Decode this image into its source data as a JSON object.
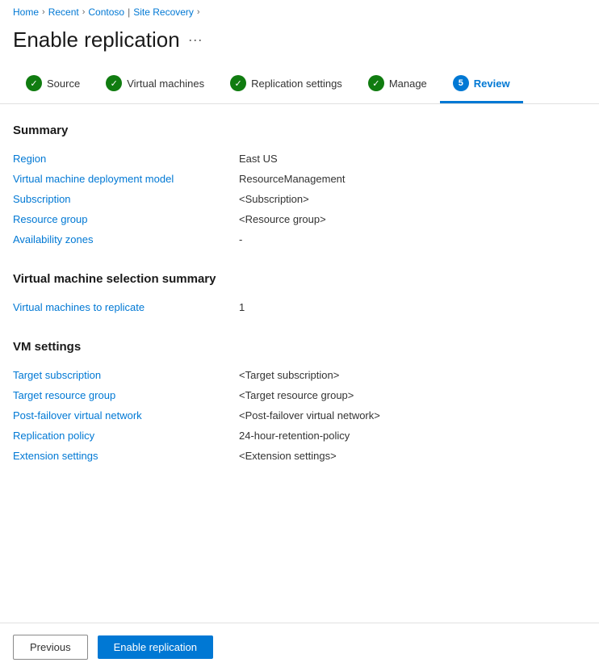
{
  "breadcrumb": {
    "home": "Home",
    "recent": "Recent",
    "contoso": "Contoso",
    "site_recovery": "Site Recovery"
  },
  "page": {
    "title": "Enable replication",
    "menu_icon": "···"
  },
  "tabs": [
    {
      "id": "source",
      "label": "Source",
      "state": "completed"
    },
    {
      "id": "virtual-machines",
      "label": "Virtual machines",
      "state": "completed"
    },
    {
      "id": "replication-settings",
      "label": "Replication settings",
      "state": "completed"
    },
    {
      "id": "manage",
      "label": "Manage",
      "state": "completed"
    },
    {
      "id": "review",
      "label": "Review",
      "state": "active",
      "badge": "5"
    }
  ],
  "summary_section": {
    "title": "Summary",
    "rows": [
      {
        "label": "Region",
        "value": "East US"
      },
      {
        "label": "Virtual machine deployment model",
        "value": "ResourceManagement"
      },
      {
        "label": "Subscription",
        "value": "<Subscription>"
      },
      {
        "label": "Resource group",
        "value": "<Resource group>"
      },
      {
        "label": "Availability zones",
        "value": "-"
      }
    ]
  },
  "vm_selection_section": {
    "title": "Virtual machine selection summary",
    "rows": [
      {
        "label": "Virtual machines to replicate",
        "value": "1"
      }
    ]
  },
  "vm_settings_section": {
    "title": "VM settings",
    "rows": [
      {
        "label": "Target subscription",
        "value": "<Target subscription>",
        "is_link": false
      },
      {
        "label": "Target resource group",
        "value": "<Target resource group>",
        "is_link": false
      },
      {
        "label": "Post-failover virtual network",
        "value": "<Post-failover virtual network>",
        "is_link": false
      },
      {
        "label": "Replication policy",
        "value": "24-hour-retention-policy",
        "is_link": true
      },
      {
        "label": "Extension settings",
        "value": "<Extension settings>",
        "is_link": false
      }
    ]
  },
  "footer": {
    "previous_label": "Previous",
    "enable_label": "Enable replication"
  }
}
